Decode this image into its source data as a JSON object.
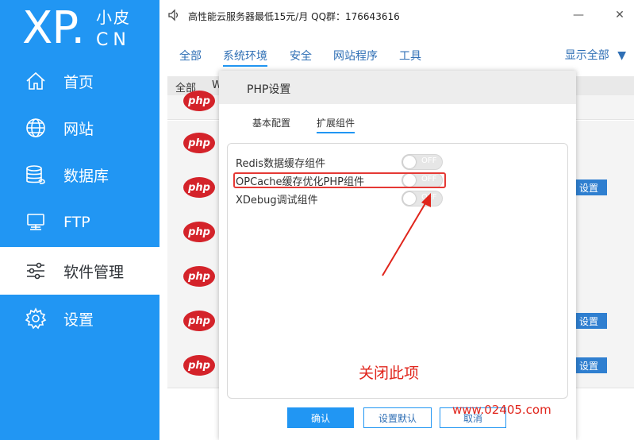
{
  "brand": {
    "xp": "XP.",
    "cn_top": "小皮",
    "cn_bottom": "CN"
  },
  "sidebar": {
    "items": [
      {
        "label": "首页",
        "icon": "home-icon"
      },
      {
        "label": "网站",
        "icon": "globe-icon"
      },
      {
        "label": "数据库",
        "icon": "database-icon"
      },
      {
        "label": "FTP",
        "icon": "monitor-icon"
      },
      {
        "label": "软件管理",
        "icon": "sliders-icon",
        "active": true
      },
      {
        "label": "设置",
        "icon": "gear-icon"
      }
    ]
  },
  "titlebar": {
    "notice": "高性能云服务器最低15元/月  QQ群：176643616",
    "minimize": "—",
    "close": "✕"
  },
  "tabs": {
    "items": [
      "全部",
      "系统环境",
      "安全",
      "网站程序",
      "工具"
    ],
    "active": "系统环境",
    "show_all": "显示全部"
  },
  "list": {
    "head_col1": "全部",
    "head_col2": "W",
    "php_logo": "php",
    "set_label": "设置"
  },
  "modal": {
    "title": "PHP设置",
    "subtabs": [
      "基本配置",
      "扩展组件"
    ],
    "options": [
      {
        "label": "Redis数据缓存组件",
        "state": "OFF"
      },
      {
        "label": "OPCache缓存优化PHP组件",
        "state": "OFF"
      },
      {
        "label": "XDebug调试组件",
        "state": "OFF"
      }
    ],
    "annotation": "关闭此项",
    "buttons": {
      "confirm": "确认",
      "reset": "设置默认",
      "cancel": "取消"
    }
  },
  "watermark": "www.02405.com",
  "colors": {
    "sidebar": "#2196f3",
    "accent": "#2196f3",
    "annotation": "#e0251c"
  }
}
